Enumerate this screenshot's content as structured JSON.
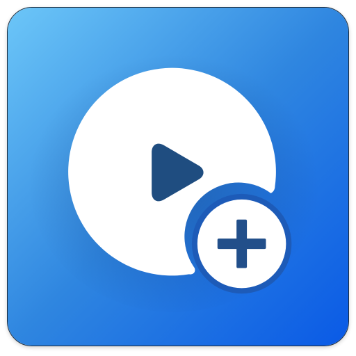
{
  "icon": {
    "name": "add-video-app-icon",
    "glyphs": [
      "play-icon",
      "plus-icon"
    ]
  },
  "colors": {
    "gradient_start": "#6cc6f8",
    "gradient_mid": "#2f86e0",
    "gradient_end": "#0a5ae6",
    "disc": "#ffffff",
    "play": "#1f4d80",
    "plus": "#224f8a",
    "badge_ring": "#1d5bb8"
  }
}
